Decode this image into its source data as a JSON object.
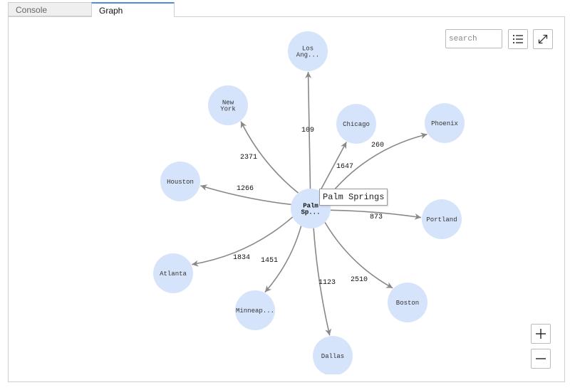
{
  "tabs": [
    {
      "label": "Console",
      "active": false
    },
    {
      "label": "Graph",
      "active": true
    }
  ],
  "toolbar": {
    "search_placeholder": "search",
    "search_value": "",
    "list_icon": "list-icon",
    "expand_icon": "expand-icon"
  },
  "zoom_controls": {
    "zoom_in_icon": "plus-icon",
    "zoom_out_icon": "minus-icon"
  },
  "tooltip": {
    "text": "Palm Springs"
  },
  "colors": {
    "node_fill": "#d6e4fb",
    "edge": "#888888",
    "tab_accent": "#4a90d9"
  },
  "graph": {
    "center": {
      "id": "palm-springs",
      "label_lines": [
        "Palm",
        "Sp..."
      ],
      "full_name": "Palm Springs"
    },
    "nodes": [
      {
        "id": "los-angeles",
        "label_lines": [
          "Los",
          "Ang..."
        ]
      },
      {
        "id": "new-york",
        "label_lines": [
          "New",
          "York"
        ]
      },
      {
        "id": "chicago",
        "label_lines": [
          "Chicago"
        ]
      },
      {
        "id": "phoenix",
        "label_lines": [
          "Phoenix"
        ]
      },
      {
        "id": "houston",
        "label_lines": [
          "Houston"
        ]
      },
      {
        "id": "portland",
        "label_lines": [
          "Portland"
        ]
      },
      {
        "id": "atlanta",
        "label_lines": [
          "Atlanta"
        ]
      },
      {
        "id": "minneapolis",
        "label_lines": [
          "Minneap..."
        ]
      },
      {
        "id": "boston",
        "label_lines": [
          "Boston"
        ]
      },
      {
        "id": "dallas",
        "label_lines": [
          "Dallas"
        ]
      }
    ],
    "edges": [
      {
        "from": "palm-springs",
        "to": "los-angeles",
        "label": "109"
      },
      {
        "from": "palm-springs",
        "to": "new-york",
        "label": "2371"
      },
      {
        "from": "palm-springs",
        "to": "chicago",
        "label": "1647"
      },
      {
        "from": "palm-springs",
        "to": "phoenix",
        "label": "260"
      },
      {
        "from": "palm-springs",
        "to": "houston",
        "label": "1266"
      },
      {
        "from": "palm-springs",
        "to": "portland",
        "label": "873"
      },
      {
        "from": "palm-springs",
        "to": "atlanta",
        "label": "1834"
      },
      {
        "from": "palm-springs",
        "to": "minneapolis",
        "label": "1451"
      },
      {
        "from": "palm-springs",
        "to": "boston",
        "label": "2510"
      },
      {
        "from": "palm-springs",
        "to": "dallas",
        "label": "1123"
      }
    ]
  }
}
